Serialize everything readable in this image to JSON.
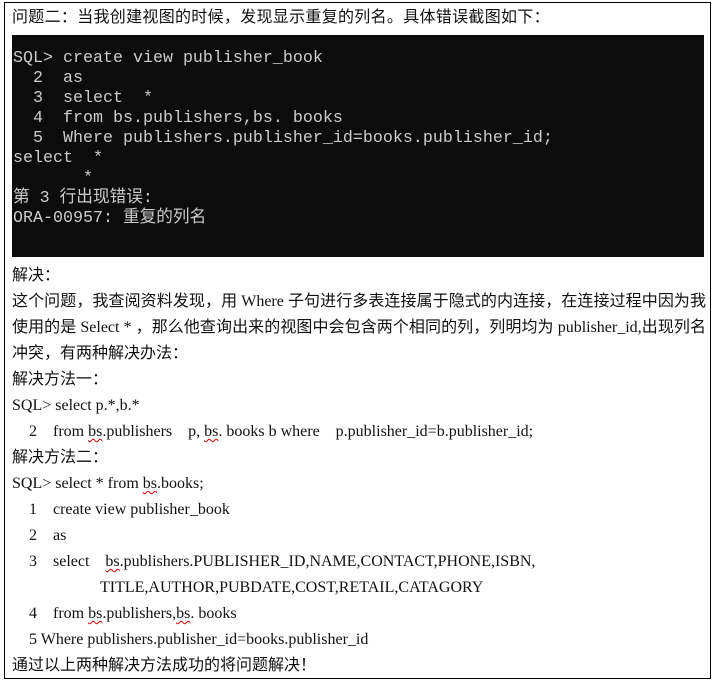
{
  "document": {
    "heading": "问题二：当我创建视图的时候，发现显示重复的列名。具体错误截图如下：",
    "terminal_screenshot": {
      "background_color": "#0c0c0c",
      "text_color": "#cccccc",
      "lines": [
        "SQL> create view publisher_book",
        "  2  as",
        "  3  select  *",
        "  4  from bs.publishers,bs. books",
        "  5  Where publishers.publisher_id=books.publisher_id;",
        "select  *",
        "       *",
        "第 3 行出现错误:",
        "ORA-00957: 重复的列名"
      ]
    },
    "solution_label": "解决：",
    "explanation": "这个问题，我查阅资料发现，用 Where 子句进行多表连接属于隐式的内连接，在连接过程中因为我使用的是 Select * ，那么他查询出来的视图中会包含两个相同的列，列明均为 publisher_id,出现列名冲突，有两种解决办法：",
    "method_one": {
      "title": "解决方法一：",
      "line1": "SQL> select    p.*,b.*",
      "line2": {
        "num": "2",
        "pre": "from ",
        "sq1": "bs",
        "mid1": ".publishers    p, ",
        "sq2": "bs",
        "post": ". books b where    p.publisher_id=b.publisher_id;"
      }
    },
    "method_two": {
      "title": "解决方法二：",
      "line0": {
        "pre": "SQL> select * from ",
        "sq": "bs",
        "post": ".books;"
      },
      "line1": {
        "num": "1",
        "text": "create view publisher_book"
      },
      "line2": {
        "num": "2",
        "text": "as"
      },
      "line3": {
        "num": "3",
        "pre": "select    ",
        "sq": "bs",
        "post": ".publishers.PUBLISHER_ID,NAME,CONTACT,PHONE,ISBN,"
      },
      "line3_cont": "TITLE,AUTHOR,PUBDATE,COST,RETAIL,CATAGORY",
      "line4": {
        "num": "4",
        "pre": "from ",
        "sq1": "bs",
        "mid": ".publishers,",
        "sq2": "bs",
        "post": ". books"
      },
      "line5": "5 Where publishers.publisher_id=books.publisher_id"
    },
    "conclusion": "通过以上两种解决方法成功的将问题解决！",
    "spellcheck_color": "#d40000"
  }
}
